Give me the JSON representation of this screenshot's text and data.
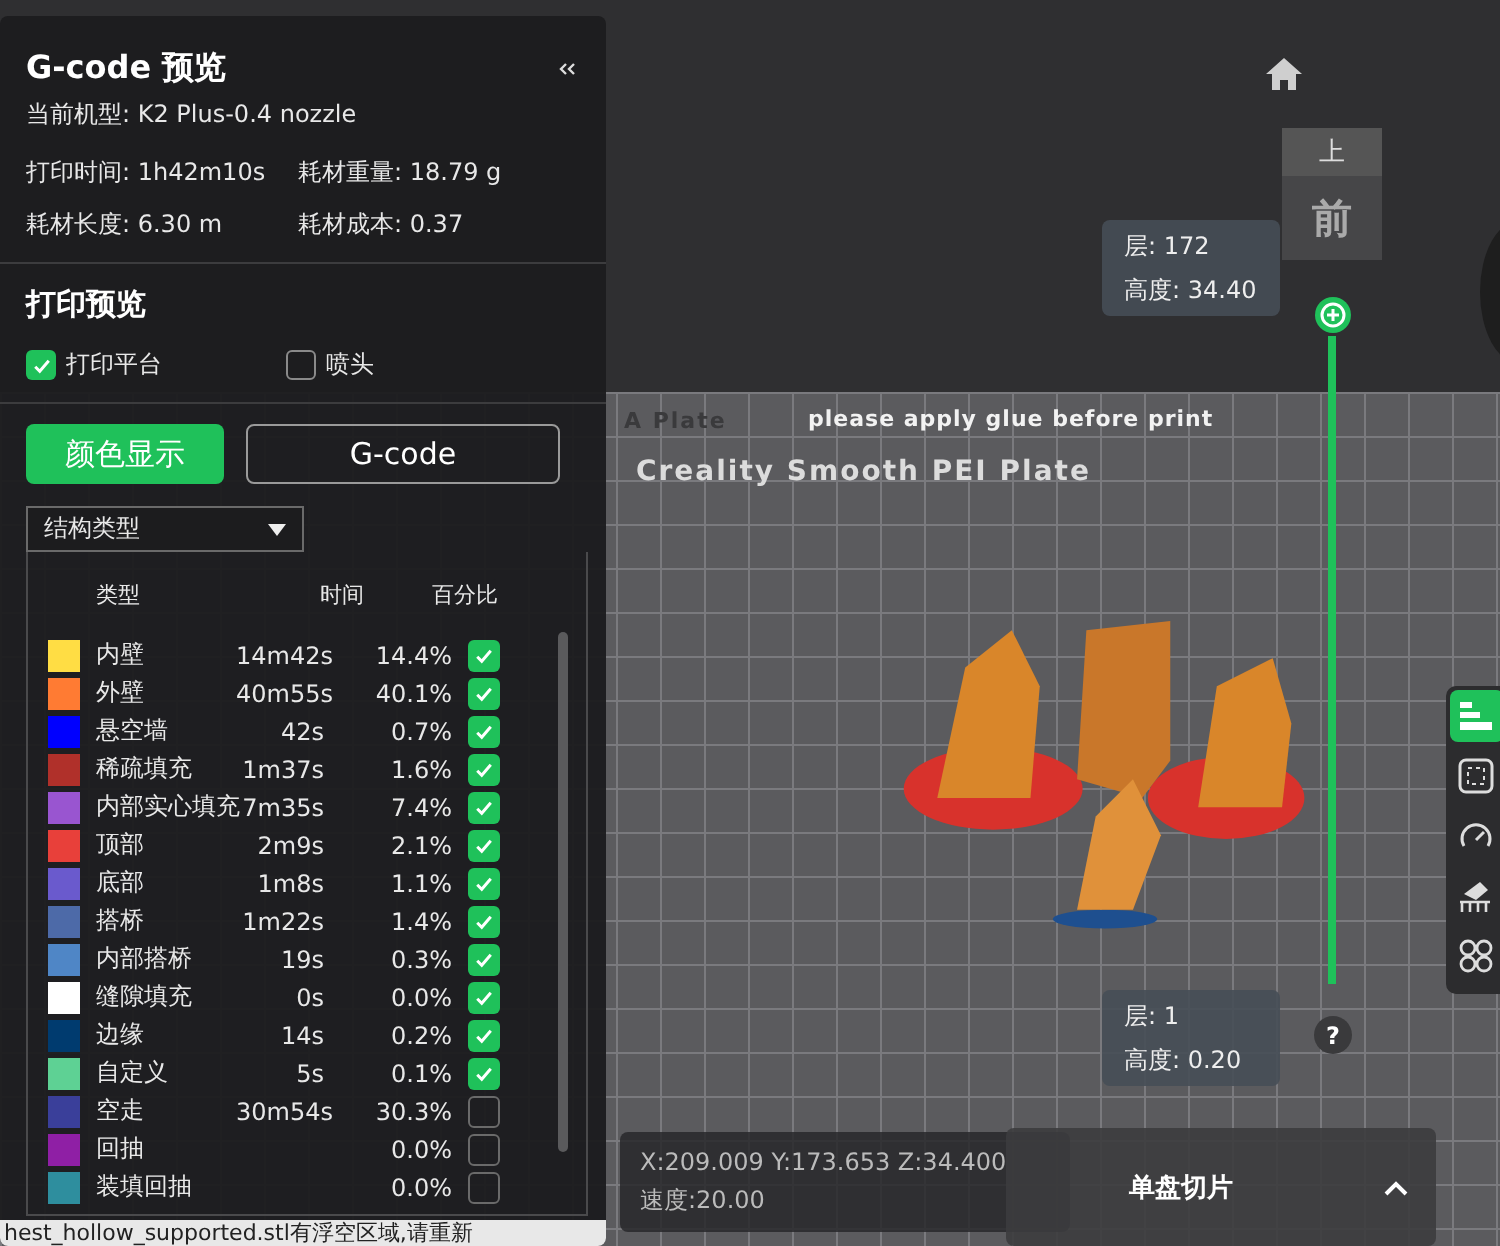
{
  "panel": {
    "title": "G-code 预览",
    "machine": "当前机型: K2 Plus-0.4 nozzle",
    "stats": [
      "打印时间: 1h42m10s",
      "耗材重量: 18.79 g",
      "耗材长度: 6.30 m",
      "耗材成本: 0.37"
    ],
    "preview_title": "打印预览",
    "options": [
      {
        "label": "打印平台",
        "checked": true
      },
      {
        "label": "喷头",
        "checked": false
      }
    ],
    "view_modes": [
      {
        "label": "颜色显示",
        "selected": true
      },
      {
        "label": "G-code",
        "selected": false
      }
    ],
    "dropdown": "结构类型",
    "table": {
      "columns": [
        "类型",
        "时间",
        "百分比"
      ],
      "rows": [
        {
          "name": "内壁",
          "color": "#ffdd44",
          "time": "14m42s",
          "percent": "14.4%",
          "checked": true
        },
        {
          "name": "外壁",
          "color": "#ff7b33",
          "time": "40m55s",
          "percent": "40.1%",
          "checked": true
        },
        {
          "name": "悬空墙",
          "color": "#0000ff",
          "time": "42s",
          "percent": "0.7%",
          "checked": true
        },
        {
          "name": "稀疏填充",
          "color": "#b0302a",
          "time": "1m37s",
          "percent": "1.6%",
          "checked": true
        },
        {
          "name": "内部实心填充",
          "color": "#9955d0",
          "time": "7m35s",
          "percent": "7.4%",
          "checked": true
        },
        {
          "name": "顶部",
          "color": "#e8403a",
          "time": "2m9s",
          "percent": "2.1%",
          "checked": true
        },
        {
          "name": "底部",
          "color": "#6a5acd",
          "time": "1m8s",
          "percent": "1.1%",
          "checked": true
        },
        {
          "name": "搭桥",
          "color": "#4d6aa8",
          "time": "1m22s",
          "percent": "1.4%",
          "checked": true
        },
        {
          "name": "内部搭桥",
          "color": "#4f86c6",
          "time": "19s",
          "percent": "0.3%",
          "checked": true
        },
        {
          "name": "缝隙填充",
          "color": "#ffffff",
          "time": "0s",
          "percent": "0.0%",
          "checked": true
        },
        {
          "name": "边缘",
          "color": "#003b6f",
          "time": "14s",
          "percent": "0.2%",
          "checked": true
        },
        {
          "name": "自定义",
          "color": "#5ed194",
          "time": "5s",
          "percent": "0.1%",
          "checked": true
        },
        {
          "name": "空走",
          "color": "#3a3f9a",
          "time": "30m54s",
          "percent": "30.3%",
          "checked": false
        },
        {
          "name": "回抽",
          "color": "#8f1fa5",
          "percent": "0.0%",
          "checked": false
        },
        {
          "name": "装填回抽",
          "color": "#2e8e9e",
          "percent": "0.0%",
          "checked": false
        }
      ]
    }
  },
  "plate": {
    "name": "A Plate",
    "notice": "please apply glue before print",
    "label": "Creality Smooth PEI Plate"
  },
  "layer_slider": {
    "top": {
      "layer": "层: 172",
      "height": "高度: 34.40"
    },
    "bottom": {
      "layer": "层: 1",
      "height": "高度: 0.20"
    },
    "help": "?"
  },
  "view_cube": {
    "top": "上",
    "front": "前"
  },
  "toolbar": [
    {
      "kind": "legend",
      "selected": true
    },
    {
      "kind": "select",
      "selected": false
    },
    {
      "kind": "speed",
      "selected": false
    },
    {
      "kind": "support",
      "selected": false
    },
    {
      "kind": "parts",
      "selected": false
    }
  ],
  "coordinates": {
    "position": "X:209.009 Y:173.653 Z:34.400",
    "speed": "速度:20.00"
  },
  "slice_button": {
    "label": "单盘切片"
  },
  "status": {
    "message": "hest_hollow_supported.stl有浮空区域,请重新"
  }
}
